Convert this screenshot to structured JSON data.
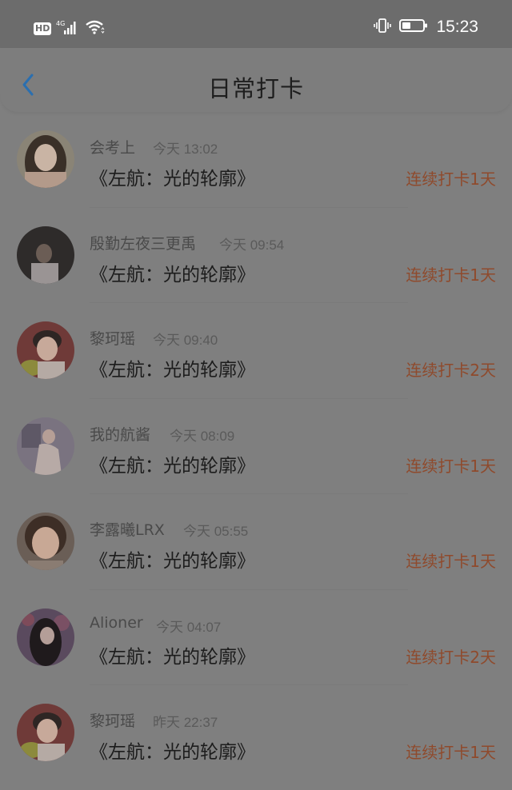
{
  "status_bar": {
    "hd_label": "HD",
    "network_label": "4G",
    "time": "15:23"
  },
  "nav": {
    "title": "日常打卡"
  },
  "colors": {
    "streak": "#8f4a2c",
    "accent": "#2a6fb0"
  },
  "items": [
    {
      "user": "会考上",
      "time": "今天 13:02",
      "book": "《左航：光的轮廓》",
      "streak": "连续打卡1天"
    },
    {
      "user": "殷勤左夜三更禹",
      "time": "今天 09:54",
      "book": "《左航：光的轮廓》",
      "streak": "连续打卡1天"
    },
    {
      "user": "黎珂瑶",
      "time": "今天 09:40",
      "book": "《左航：光的轮廓》",
      "streak": "连续打卡2天"
    },
    {
      "user": "我的航酱",
      "time": "今天 08:09",
      "book": "《左航：光的轮廓》",
      "streak": "连续打卡1天"
    },
    {
      "user": "李露曦LRX",
      "time": "今天 05:55",
      "book": "《左航：光的轮廓》",
      "streak": "连续打卡1天"
    },
    {
      "user": "Alioner",
      "time": "今天 04:07",
      "book": "《左航：光的轮廓》",
      "streak": "连续打卡2天"
    },
    {
      "user": "黎珂瑶",
      "time": "昨天 22:37",
      "book": "《左航：光的轮廓》",
      "streak": "连续打卡1天"
    }
  ]
}
